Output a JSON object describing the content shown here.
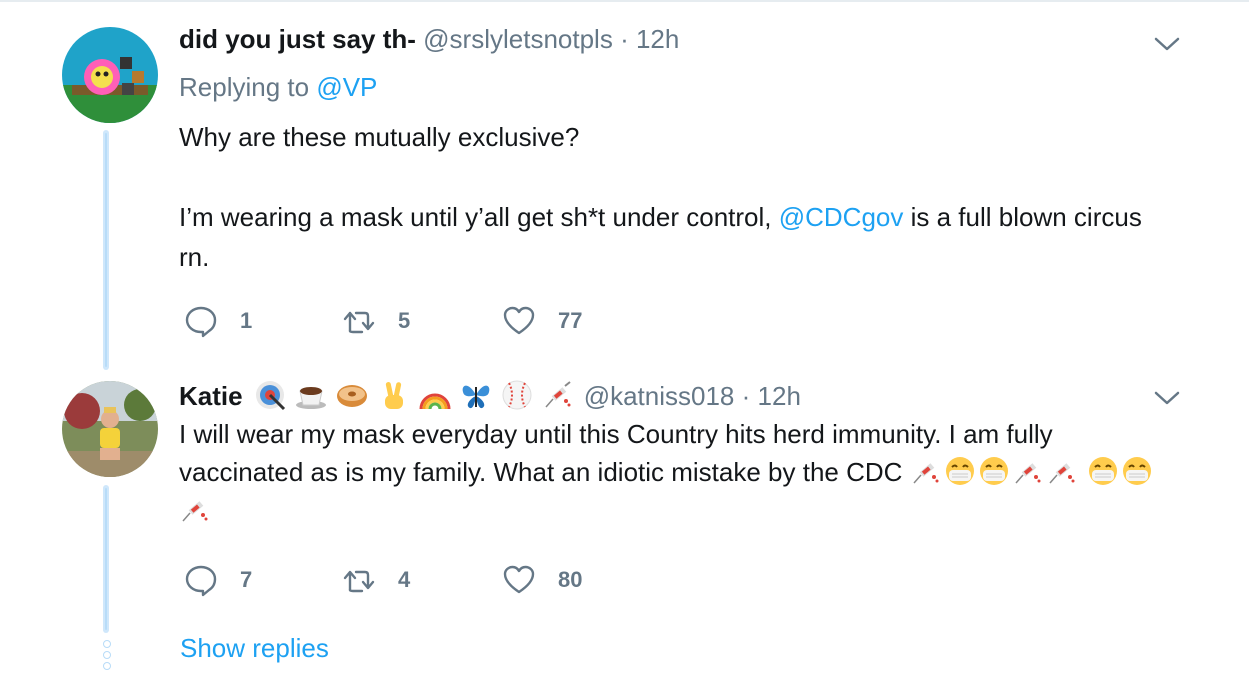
{
  "tweets": [
    {
      "name": "did you just say th-",
      "handle": "@srslyletsnotpls",
      "sep": "·",
      "time": "12h",
      "reply_prefix": "Replying to",
      "reply_handle": "@VP",
      "line1": "Why are these mutually exclusive?",
      "line2_a": "I’m wearing a mask until y’all get sh*t under control,",
      "line2_mention": "@CDCgov",
      "line2_b": "is a full blown circus rn.",
      "reply_count": "1",
      "retweet_count": "5",
      "like_count": "77"
    },
    {
      "name": "Katie",
      "handle": "@katniss018",
      "sep": "·",
      "time": "12h",
      "text": "I will wear my mask everyday until this Country hits herd immunity. I am fully vaccinated as is my family. What an idiotic mistake by the CDC",
      "reply_count": "7",
      "retweet_count": "4",
      "like_count": "80"
    }
  ],
  "name_emojis": [
    "target-emoji",
    "coffee-emoji",
    "bagel-emoji",
    "victory-hand-emoji",
    "rainbow-emoji",
    "butterfly-emoji",
    "baseball-emoji",
    "syringe-emoji"
  ],
  "body_emojis": [
    "syringe-emoji",
    "mask-face-emoji",
    "mask-face-emoji",
    "syringe-emoji",
    "syringe-emoji",
    "mask-face-emoji",
    "mask-face-emoji",
    "syringe-emoji"
  ],
  "show_replies": "Show replies",
  "colors": {
    "accent": "#1da1f2",
    "muted": "#657786",
    "thread_line": "#cfe7fb"
  }
}
